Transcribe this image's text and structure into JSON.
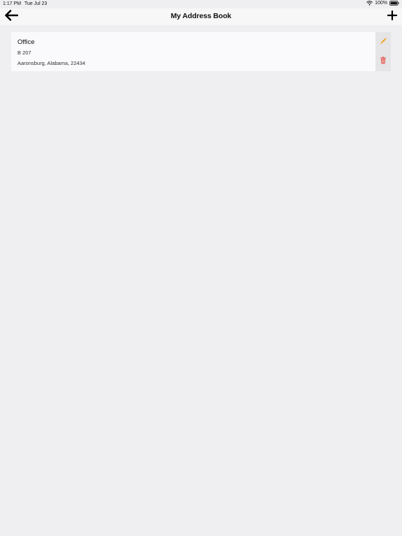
{
  "status_bar": {
    "time": "1:17 PM",
    "date": "Tue Jul 23",
    "battery": "100%"
  },
  "nav": {
    "title": "My Address Book",
    "back_icon": "arrow-left-icon",
    "add_icon": "plus-icon"
  },
  "addresses": [
    {
      "name": "Office",
      "line1": "B 207",
      "line2": "Aaronsburg, Alabama, 22434",
      "edit_icon": "pencil-icon",
      "delete_icon": "trash-icon"
    }
  ],
  "colors": {
    "background": "#efeef1",
    "card": "#faf9fb",
    "actions_bg": "#e5e4e6",
    "edit": "#f0a21f",
    "delete": "#e2625a"
  }
}
